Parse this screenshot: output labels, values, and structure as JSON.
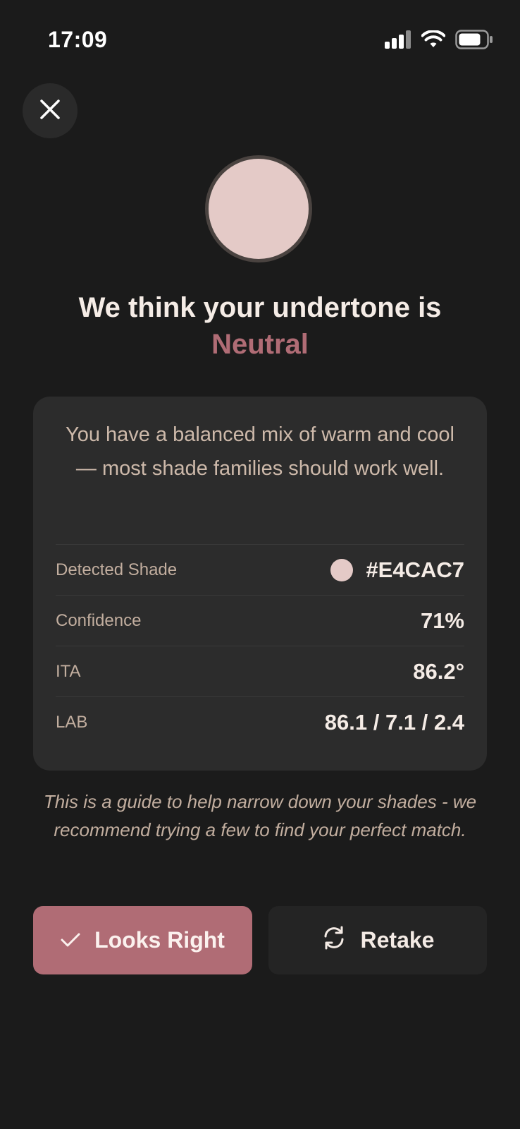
{
  "status_bar": {
    "time": "17:09"
  },
  "icons": {
    "close": "close-icon",
    "signal": "cellular-signal-icon",
    "wifi": "wifi-icon",
    "battery": "battery-icon",
    "check": "checkmark-icon",
    "retake": "refresh-icon"
  },
  "result": {
    "headline": "We think your undertone is",
    "undertone": "Neutral",
    "undertone_color": "#b06c75",
    "swatch_color": "#E4CAC7"
  },
  "details": {
    "description": "You have a balanced mix of warm and cool — most shade families should work well.",
    "rows": [
      {
        "label": "Detected Shade",
        "value": "#E4CAC7"
      },
      {
        "label": "Confidence",
        "value": "71%"
      },
      {
        "label": "ITA",
        "value": "86.2°"
      },
      {
        "label": "LAB",
        "value": "86.1 / 7.1 / 2.4"
      }
    ]
  },
  "disclaimer": "This is a guide to help narrow down your shades - we recommend trying a few to find your perfect match.",
  "actions": {
    "confirm_label": "Looks Right",
    "retake_label": "Retake"
  },
  "colors": {
    "background": "#1b1b1b",
    "card": "#2c2c2c",
    "accent": "#b06c75",
    "secondary_button": "#242424"
  }
}
